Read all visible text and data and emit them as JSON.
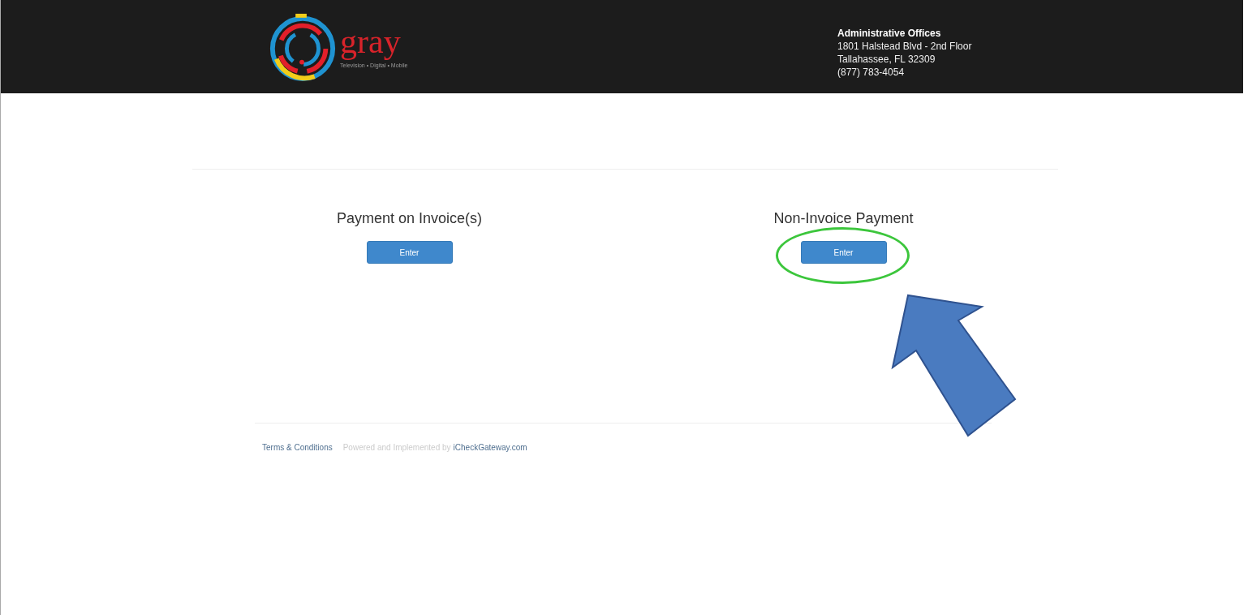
{
  "header": {
    "logo": {
      "wordmark": "gray",
      "tagline": "Television • Digital • Mobile"
    },
    "address": {
      "title": "Administrative Offices",
      "lines": [
        "1801 Halstead Blvd - 2nd Floor",
        "Tallahassee, FL 32309",
        "(877) 783-4054"
      ]
    }
  },
  "options": [
    {
      "title": "Payment on Invoice(s)",
      "button": "Enter"
    },
    {
      "title": "Non-Invoice Payment",
      "button": "Enter"
    }
  ],
  "footer": {
    "link": "Terms & Conditions",
    "credit": "Powered and Implemented by",
    "credit_link": "iCheckGateway.com"
  },
  "annotations": {
    "highlight_ellipse": true,
    "pointer_arrow": true
  }
}
